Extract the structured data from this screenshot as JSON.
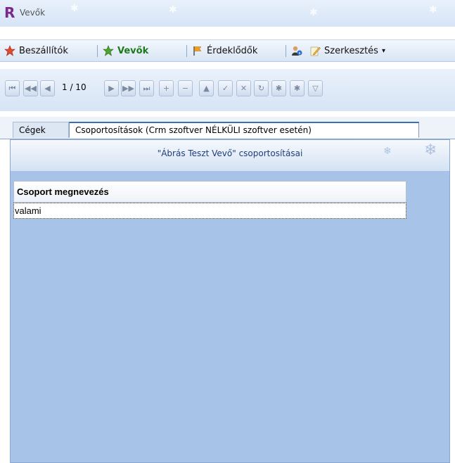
{
  "window": {
    "title": "Vevők",
    "logo": "R"
  },
  "menu": {
    "items": [
      {
        "label": "Beszállítók",
        "icon": "star-red-icon"
      },
      {
        "label": "Vevők",
        "icon": "star-green-icon",
        "active": true
      },
      {
        "label": "Érdeklődők",
        "icon": "flag-icon"
      },
      {
        "label": "",
        "icon": "user-info-icon"
      },
      {
        "label": "Szerkesztés",
        "icon": "edit-icon",
        "dropdown": "▾"
      }
    ]
  },
  "navigator": {
    "counter": "1 / 10",
    "buttons": [
      "first",
      "prev-page",
      "prev",
      "next",
      "next-page",
      "last",
      "add",
      "delete",
      "up",
      "post",
      "cancel",
      "refresh",
      "asterisk",
      "mark",
      "filter"
    ]
  },
  "tabs": [
    {
      "label": "Cégek",
      "active": false
    },
    {
      "label": "Csoportosítások (Crm szoftver NÉLKÜLI szoftver esetén)",
      "active": true
    }
  ],
  "panel": {
    "caption": "\"Ábrás Teszt Vevő\" csoportosításai"
  },
  "grid": {
    "columns": [
      "Csoport megnevezés"
    ],
    "rows": [
      [
        "valami"
      ]
    ]
  },
  "colors": {
    "accent": "#3a6fb7",
    "panel_bg": "#a8c3e8",
    "active_menu": "#1a7a1a"
  }
}
